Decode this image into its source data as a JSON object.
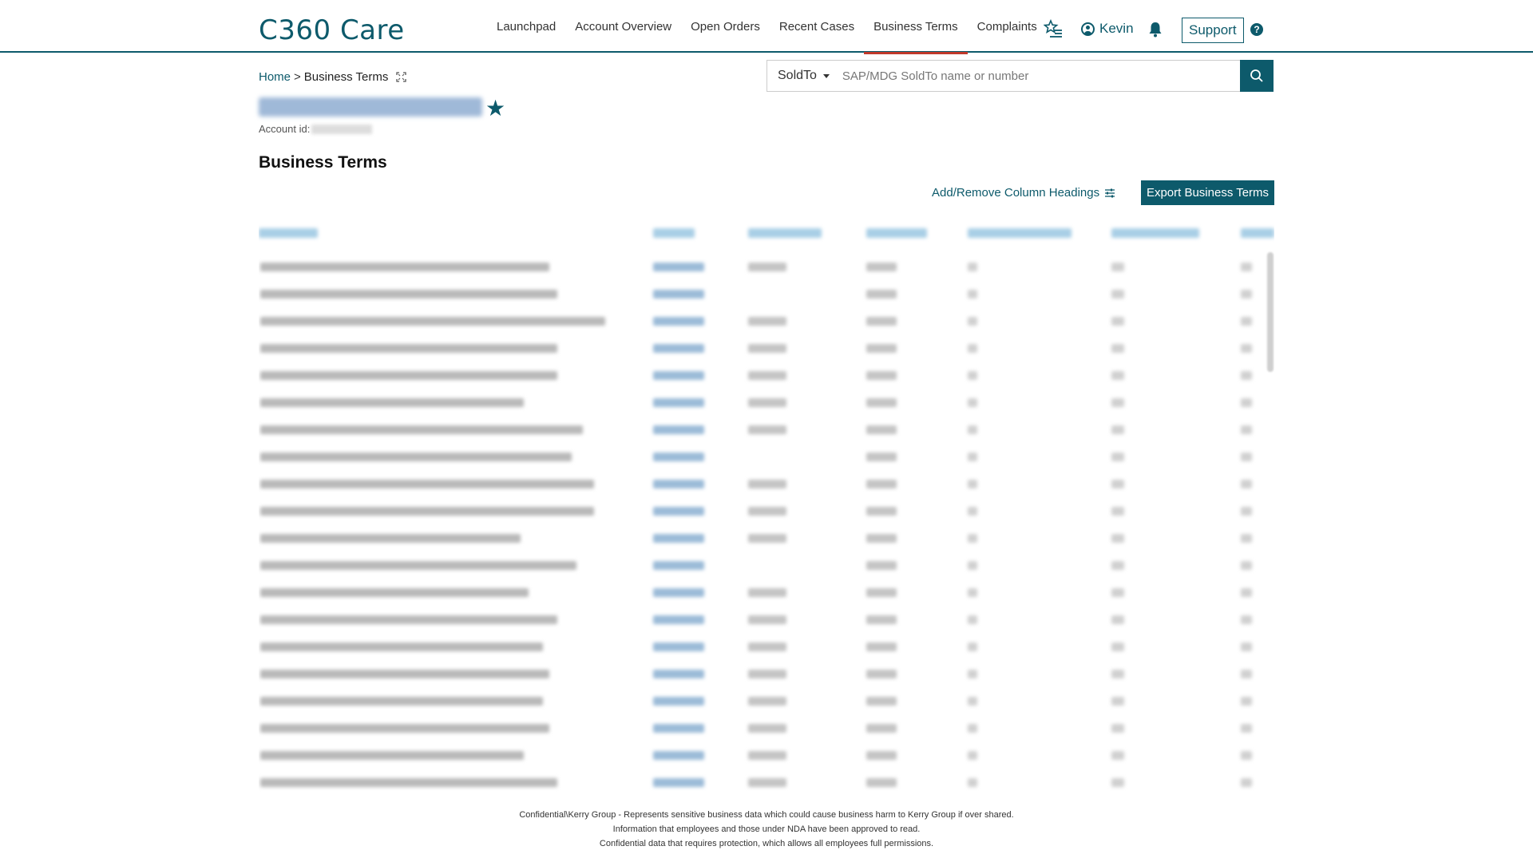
{
  "header": {
    "brand": "C360 Care",
    "nav": [
      "Launchpad",
      "Account Overview",
      "Open Orders",
      "Recent Cases",
      "Business Terms",
      "Complaints"
    ],
    "active_nav": "Business Terms",
    "user_name": "Kevin",
    "support_label": "Support",
    "help_label": "?"
  },
  "breadcrumb": {
    "home": "Home",
    "separator": ">",
    "current": "Business Terms"
  },
  "account": {
    "id_label": "Account id:"
  },
  "search": {
    "field_label": "SoldTo",
    "placeholder": "SAP/MDG SoldTo name or number"
  },
  "page": {
    "title": "Business Terms",
    "column_headings_link": "Add/Remove Column Headings",
    "export_label": "Export Business Terms"
  },
  "footer": {
    "lines": [
      "Confidential\\Kerry Group - Represents sensitive business data which could cause business harm to Kerry Group if over shared.",
      "Information that employees and those under NDA have been approved to read.",
      "Confidential data that requires protection, which allows all employees full permissions."
    ]
  },
  "colors": {
    "brand": "#0d5a6b",
    "active_underline": "#c0392b"
  }
}
